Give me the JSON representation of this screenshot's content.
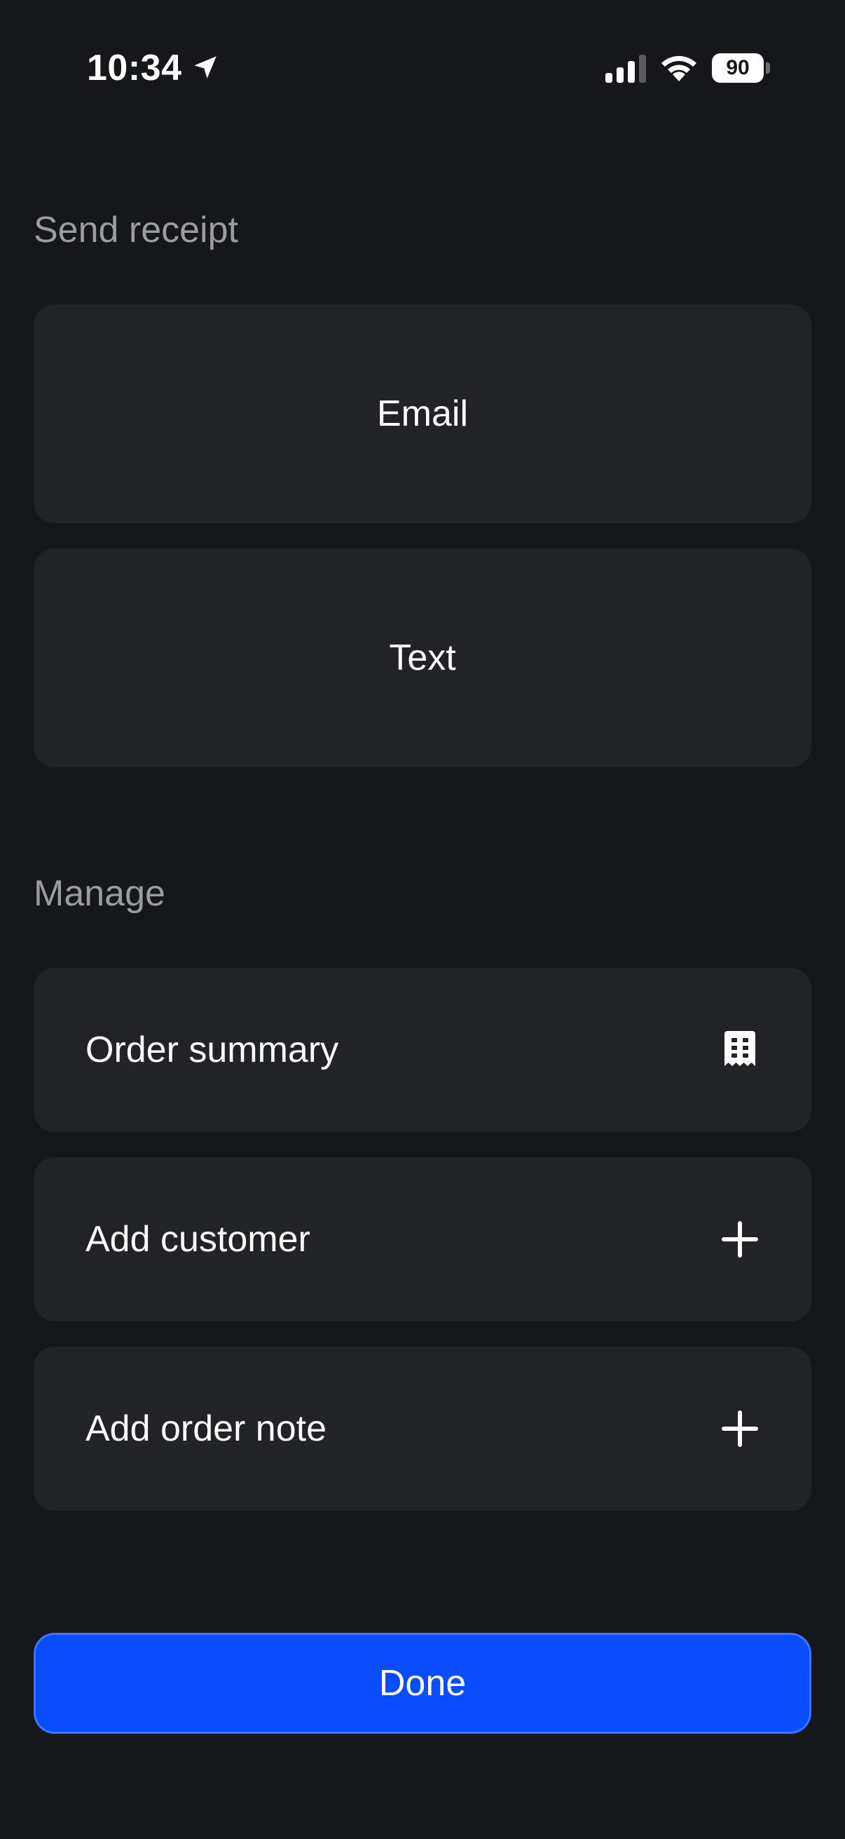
{
  "status_bar": {
    "time": "10:34",
    "battery": "90",
    "icons": [
      "location-arrow-icon",
      "cellular-signal-icon",
      "wifi-icon",
      "battery-icon"
    ]
  },
  "send_receipt": {
    "header": "Send receipt",
    "email_label": "Email",
    "text_label": "Text"
  },
  "manage": {
    "header": "Manage",
    "items": [
      {
        "label": "Order summary",
        "icon": "receipt-icon"
      },
      {
        "label": "Add customer",
        "icon": "plus-icon"
      },
      {
        "label": "Add order note",
        "icon": "plus-icon"
      }
    ]
  },
  "done_label": "Done",
  "colors": {
    "background": "#16171b",
    "card": "#222327",
    "section_label": "#9a9ca3",
    "accent": "#0a4cff"
  }
}
